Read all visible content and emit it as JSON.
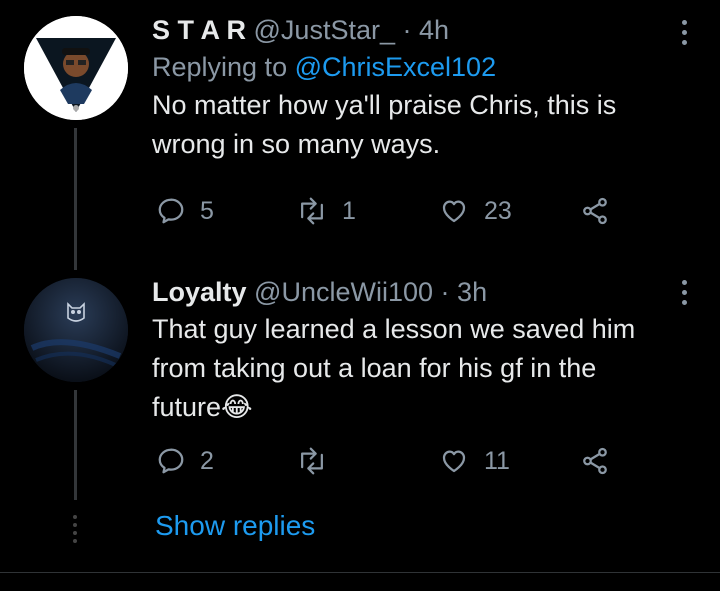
{
  "tweets": [
    {
      "name": "S T A R",
      "handle": "@JustStar_",
      "separator": "·",
      "time": "4h",
      "replying_prefix": "Replying to",
      "replying_to": "@ChrisExcel102",
      "text_line1": "No matter how ya'll praise Chris, this is",
      "text_line2": "wrong in so many ways.",
      "replies": "5",
      "retweets": "1",
      "likes": "23"
    },
    {
      "name": "Loyalty",
      "handle": "@UncleWii100",
      "separator": "·",
      "time": "3h",
      "text_line1": "That guy learned a lesson we saved him",
      "text_line2": "from taking out a loan for his gf in the",
      "text_line3": "future😂",
      "replies": "2",
      "retweets": "",
      "likes": "11"
    }
  ],
  "show_replies": "Show replies",
  "colors": {
    "background": "#000000",
    "primary_text": "#e7e9ea",
    "secondary_text": "#8b98a5",
    "accent": "#1d9bf0",
    "thread_line": "#333639"
  }
}
